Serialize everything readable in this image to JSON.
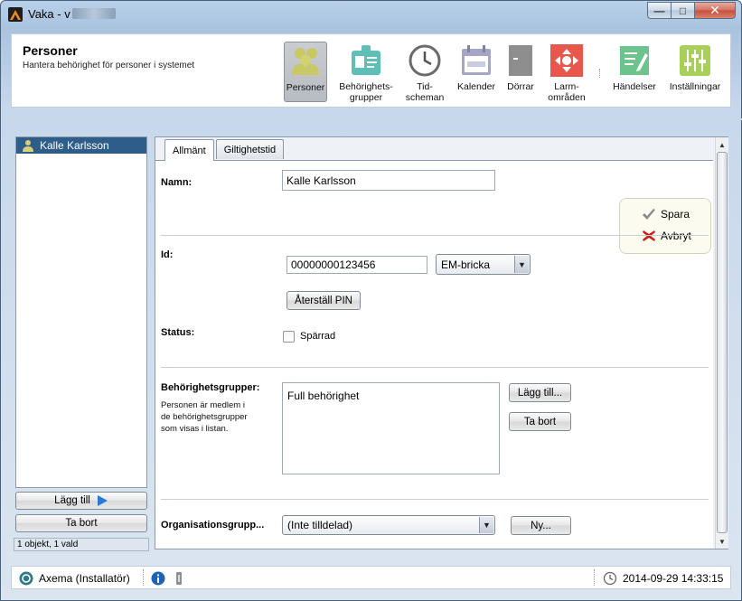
{
  "window": {
    "title": "Vaka - v",
    "minimize_glyph": "—",
    "maximize_glyph": "□",
    "close_glyph": "✕"
  },
  "header": {
    "title": "Personer",
    "subtitle": "Hantera behörighet för personer i systemet"
  },
  "nav": {
    "items": [
      {
        "line1": "Personer",
        "line2": "",
        "icon": "people-icon",
        "color": "#c8c964",
        "active": true
      },
      {
        "line1": "Behörighets-",
        "line2": "grupper",
        "icon": "id-badge-icon",
        "color": "#5fbfb7"
      },
      {
        "line1": "Tid-",
        "line2": "scheman",
        "icon": "clock-icon",
        "color": "#6a6a6a"
      },
      {
        "line1": "Kalender",
        "line2": "",
        "icon": "calendar-icon",
        "color": "#a4a6c4"
      },
      {
        "line1": "Dörrar",
        "line2": "",
        "icon": "door-icon",
        "color": "#8e8e8e"
      },
      {
        "line1": "Larm-",
        "line2": "områden",
        "icon": "alarm-area-icon",
        "color": "#e9564b"
      },
      {
        "line1": "Händelser",
        "line2": "",
        "icon": "event-log-icon",
        "color": "#6cc38c"
      },
      {
        "line1": "Inställningar",
        "line2": "",
        "icon": "settings-sliders-icon",
        "color": "#a8cf5a"
      }
    ]
  },
  "left": {
    "selected_person": "Kalle Karlsson",
    "add_button": "Lägg till",
    "remove_button": "Ta bort",
    "status": "1 objekt, 1 vald"
  },
  "tabs": [
    {
      "label": "Allmänt",
      "active": true
    },
    {
      "label": "Giltighetstid",
      "active": false
    }
  ],
  "form": {
    "name_label": "Namn:",
    "name_value": "Kalle Karlsson",
    "save_label": "Spara",
    "cancel_label": "Avbryt",
    "id_label": "Id:",
    "id_value": "00000000123456",
    "id_type": "EM-bricka",
    "reset_pin_label": "Återställ PIN",
    "status_label": "Status:",
    "blocked_label": "Spärrad",
    "blocked_checked": false,
    "groups_label": "Behörighetsgrupper:",
    "groups_hint": [
      "Personen är medlem i",
      "de behörighetsgrupper",
      "som visas i listan."
    ],
    "groups": [
      "Full behörighet"
    ],
    "groups_add": "Lägg till...",
    "groups_remove": "Ta bort",
    "org_label": "Organisationsgrupp...",
    "org_value": "(Inte tilldelad)",
    "org_new": "Ny..."
  },
  "statusbar": {
    "user": "Axema (Installatör)",
    "datetime": "2014-09-29 14:33:15"
  }
}
